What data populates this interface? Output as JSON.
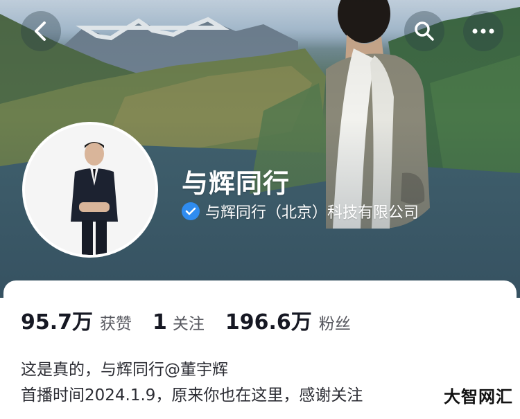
{
  "header": {
    "back_icon": "chevron-left-icon",
    "search_icon": "search-icon",
    "more_icon": "more-horizontal-icon"
  },
  "profile": {
    "name": "与辉同行",
    "verified_org": "与辉同行（北京）科技有限公司",
    "verified_icon": "verified-check-icon",
    "verified_color": "#2f8cf0"
  },
  "stats": [
    {
      "value": "95.7万",
      "label": "获赞"
    },
    {
      "value": "1",
      "label": "关注"
    },
    {
      "value": "196.6万",
      "label": "粉丝"
    }
  ],
  "bio": {
    "line1": "这是真的，与辉同行@董宇辉",
    "line2": "首播时间2024.1.9，原来你也在这里，感谢关注"
  },
  "watermark": {
    "text": "大智网汇"
  }
}
